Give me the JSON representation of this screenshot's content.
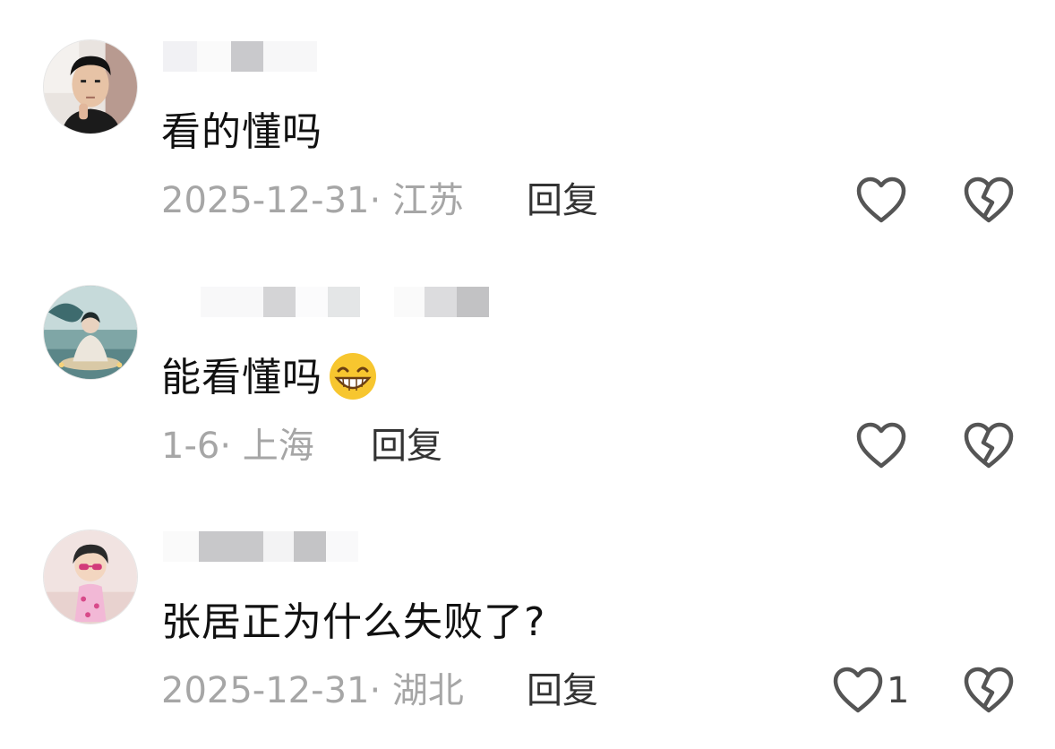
{
  "comments": [
    {
      "text": "看的懂吗",
      "date": "2025-12-31",
      "separator": "·",
      "location": "江苏",
      "reply_label": "回复",
      "like_icon": "heart-outline-icon",
      "dislike_icon": "broken-heart-icon"
    },
    {
      "text": "能看懂吗",
      "emoji": "grinning-face-emoji",
      "date": "1-6",
      "separator": "·",
      "location": "上海",
      "reply_label": "回复",
      "like_icon": "heart-outline-icon",
      "dislike_icon": "broken-heart-icon"
    },
    {
      "text": "张居正为什么失败了?",
      "date": "2025-12-31",
      "separator": "·",
      "location": "湖北",
      "reply_label": "回复",
      "like_count": "1",
      "like_icon": "heart-outline-icon",
      "dislike_icon": "broken-heart-icon"
    }
  ],
  "colors": {
    "text": "#111111",
    "meta": "#a6a6a6",
    "reply": "#333333",
    "icon": "#555555"
  }
}
